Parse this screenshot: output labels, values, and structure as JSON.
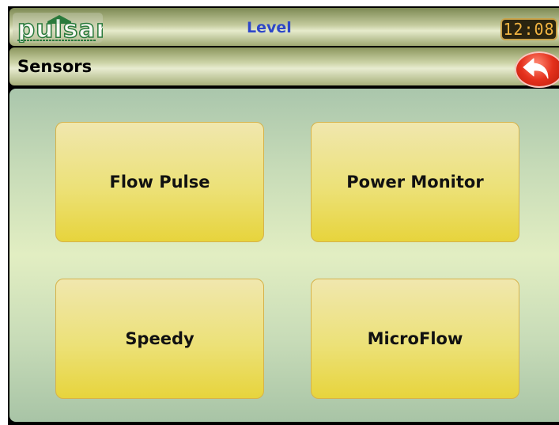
{
  "header": {
    "logo_text": "pulsar",
    "title": "Level",
    "clock": "12:08"
  },
  "section": {
    "title": "Sensors",
    "back_icon": "back-arrow-icon"
  },
  "sensors": {
    "items": [
      {
        "label": "Flow Pulse"
      },
      {
        "label": "Power Monitor"
      },
      {
        "label": "Speedy"
      },
      {
        "label": "MicroFlow"
      }
    ]
  },
  "colors": {
    "title": "#2e47c9",
    "clock_digits": "#f2b441",
    "tile_fill": "#ece178",
    "back_button": "#e4301c"
  }
}
